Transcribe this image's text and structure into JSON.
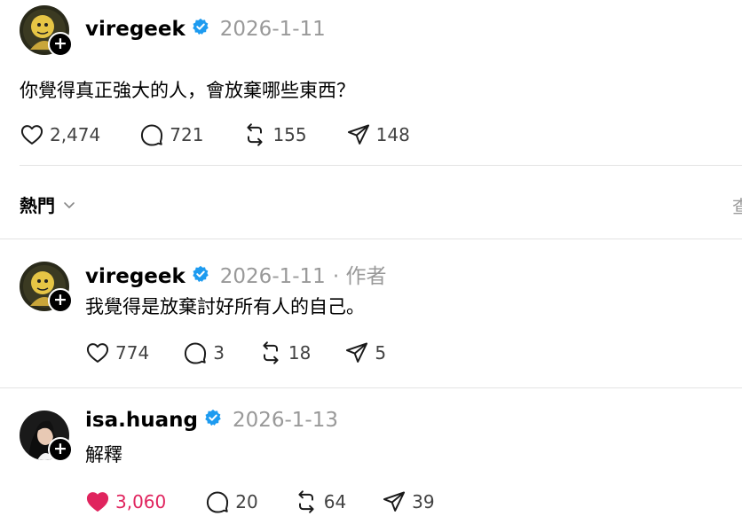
{
  "post": {
    "username": "viregeek",
    "date": "2026-1-11",
    "text": "你覺得真正強大的人，會放棄哪些東西？",
    "likes": "2,474",
    "comments": "721",
    "reposts": "155",
    "shares": "148"
  },
  "sort": {
    "label": "熱門",
    "right_label": "查"
  },
  "replies": [
    {
      "username": "viregeek",
      "date": "2026-1-11",
      "tag": "· 作者",
      "text": "我覺得是放棄討好所有人的自己。",
      "likes": "774",
      "comments": "3",
      "reposts": "18",
      "shares": "5",
      "liked": false
    },
    {
      "username": "isa.huang",
      "date": "2026-1-13",
      "text": "解釋",
      "likes": "3,060",
      "comments": "20",
      "reposts": "64",
      "shares": "39",
      "liked": true
    }
  ],
  "colors": {
    "verified": "#1d9bf0",
    "liked": "#e0245e",
    "muted": "#999999",
    "divider": "#e3e3e3"
  }
}
